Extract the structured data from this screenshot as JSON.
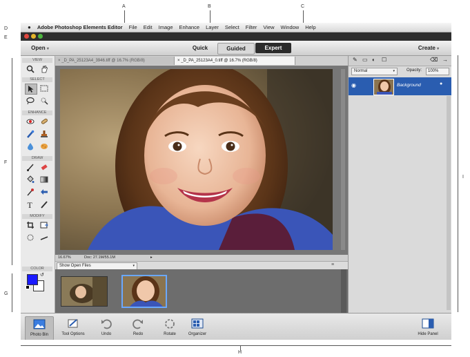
{
  "callouts": {
    "a": "A",
    "b": "B",
    "c": "C",
    "d": "D",
    "e": "E",
    "f": "F",
    "g": "G",
    "h": "H",
    "i": "I"
  },
  "menubar": {
    "apple": "",
    "items": [
      "Adobe Photoshop Elements Editor",
      "File",
      "Edit",
      "Image",
      "Enhance",
      "Layer",
      "Select",
      "Filter",
      "View",
      "Window",
      "Help"
    ]
  },
  "modebar": {
    "open": "Open",
    "quick": "Quick",
    "guided": "Guided",
    "expert": "Expert",
    "create": "Create"
  },
  "doc_tabs": [
    "_D_PA_25123A4_3946.tiff @ 16.7% (RGB/8)",
    "_D_PA_25123A4_0.tiff @ 16.7% (RGB/8)"
  ],
  "toolbox": {
    "view": "VIEW",
    "select": "SELECT",
    "enhance": "ENHANCE",
    "draw": "DRAW",
    "modify": "MODIFY",
    "color": "COLOR"
  },
  "statusbar": {
    "zoom": "16.67%",
    "doc": "Doc: 27.1M/55.1M"
  },
  "bin": {
    "dropdown": "Show Open Files"
  },
  "panel": {
    "blend": "Normal",
    "opacity_label": "Opacity:",
    "opacity": "100%",
    "layer_name": "Background"
  },
  "taskbar": {
    "photo_bin": "Photo Bin",
    "tool_options": "Tool Options",
    "undo": "Undo",
    "redo": "Redo",
    "rotate": "Rotate",
    "organizer": "Organizer",
    "hide_panel": "Hide Panel"
  },
  "colors": {
    "accent": "#2a5db0",
    "foreground_swatch": "#1a1aff",
    "mode_expert_bg": "#2b2b2b"
  }
}
